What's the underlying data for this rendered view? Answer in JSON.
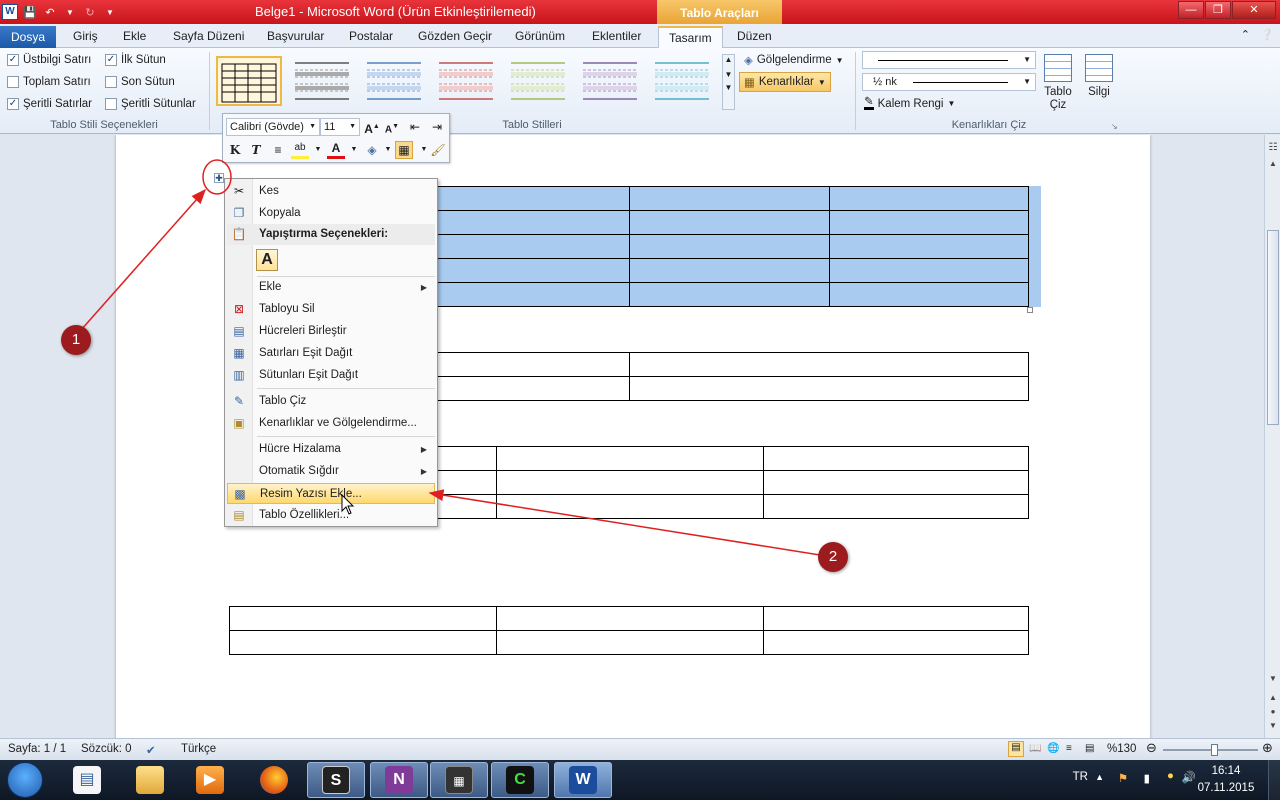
{
  "title_bar": {
    "title": "Belge1  -  Microsoft Word (Ürün Etkinleştirilemedi)",
    "contextual_tools": "Tablo Araçları",
    "word_logo": "W"
  },
  "tabs": {
    "file": "Dosya",
    "items": [
      "Giriş",
      "Ekle",
      "Sayfa Düzeni",
      "Başvurular",
      "Postalar",
      "Gözden Geçir",
      "Görünüm",
      "Eklentiler",
      "Tasarım",
      "Düzen"
    ],
    "active": "Tasarım"
  },
  "ribbon": {
    "style_options": {
      "label": "Tablo Stili Seçenekleri",
      "checkboxes": [
        {
          "label": "Üstbilgi Satırı",
          "checked": true
        },
        {
          "label": "İlk Sütun",
          "checked": true
        },
        {
          "label": "Toplam Satırı",
          "checked": false
        },
        {
          "label": "Son Sütun",
          "checked": false
        },
        {
          "label": "Şeritli Satırlar",
          "checked": true
        },
        {
          "label": "Şeritli Sütunlar",
          "checked": false
        }
      ]
    },
    "table_styles": {
      "label": "Tablo Stilleri",
      "shading": "Gölgelendirme",
      "borders": "Kenarlıklar",
      "style_colors": [
        "#000000",
        "#555555",
        "#4f81bd",
        "#c0504d",
        "#9bbb59",
        "#8064a2",
        "#4bacc6"
      ]
    },
    "draw_borders": {
      "label": "Kenarlıkları Çiz",
      "pen_weight": "½ nk",
      "pen_color": "Kalem Rengi",
      "draw_table": "Tablo Çiz",
      "eraser": "Silgi"
    }
  },
  "mini_toolbar": {
    "font": "Calibri (Gövde)",
    "size": "11",
    "bold": "K",
    "italic": "T"
  },
  "context_menu": {
    "items": [
      {
        "label": "Kes",
        "icon": "scissors-icon"
      },
      {
        "label": "Kopyala",
        "icon": "copy-icon"
      },
      {
        "label": "Yapıştırma Seçenekleri:",
        "icon": "paste-icon"
      },
      {
        "label": "Ekle",
        "icon": "",
        "submenu": true
      },
      {
        "label": "Tabloyu Sil",
        "icon": "delete-table-icon"
      },
      {
        "label": "Hücreleri Birleştir",
        "icon": "merge-cells-icon"
      },
      {
        "label": "Satırları Eşit Dağıt",
        "icon": "distribute-rows-icon"
      },
      {
        "label": "Sütunları Eşit Dağıt",
        "icon": "distribute-columns-icon"
      },
      {
        "label": "Tablo Çiz",
        "icon": "draw-table-icon"
      },
      {
        "label": "Kenarlıklar ve Gölgelendirme...",
        "icon": "borders-shading-icon"
      },
      {
        "label": "Hücre Hizalama",
        "icon": "",
        "submenu": true
      },
      {
        "label": "Otomatik Sığdır",
        "icon": "",
        "submenu": true
      },
      {
        "label": "Resim Yazısı Ekle...",
        "icon": "insert-caption-icon",
        "highlighted": true
      },
      {
        "label": "Tablo Özellikleri...",
        "icon": "table-properties-icon"
      }
    ],
    "paste_option": "A"
  },
  "annotations": {
    "badge_1": "1",
    "badge_2": "2",
    "color": "#e02020"
  },
  "status_bar": {
    "page": "Sayfa: 1 / 1",
    "words": "Sözcük: 0",
    "language": "Türkçe",
    "zoom": "%130"
  },
  "taskbar": {
    "apps": [
      "explorer",
      "media-player",
      "firefox",
      "snagit",
      "onenote",
      "terminal",
      "camtasia",
      "word"
    ],
    "active": "word",
    "language": "TR",
    "time": "16:14",
    "date": "07.11.2015"
  }
}
